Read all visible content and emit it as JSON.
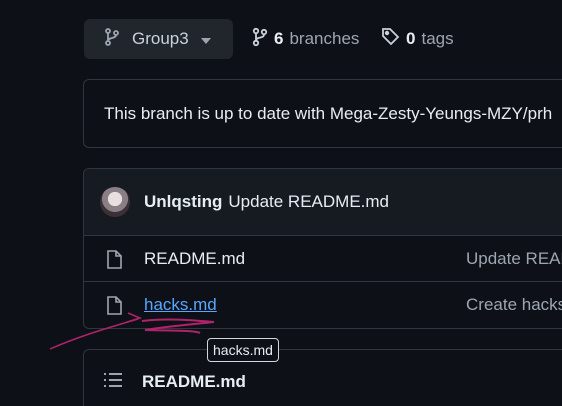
{
  "branch_selector": {
    "label": "Group3",
    "icon": "git-branch-icon"
  },
  "branches": {
    "count": "6",
    "label": "branches",
    "icon": "git-branch-icon"
  },
  "tags": {
    "count": "0",
    "label": "tags",
    "icon": "tag-icon"
  },
  "status": {
    "text": "This branch is up to date with Mega-Zesty-Yeungs-MZY/prh"
  },
  "latest_commit": {
    "author": "Unlqsting",
    "message": "Update README.md"
  },
  "files": [
    {
      "name": "README.md",
      "commit": "Update READ",
      "icon": "file-icon"
    },
    {
      "name": "hacks.md",
      "commit": "Create hacks",
      "icon": "file-icon"
    }
  ],
  "tooltip": {
    "text": "hacks.md"
  },
  "readme": {
    "title": "README.md",
    "icon": "list-icon"
  },
  "colors": {
    "background": "#0d1117",
    "link": "#58a6ff",
    "annotation": "#b0236b"
  }
}
